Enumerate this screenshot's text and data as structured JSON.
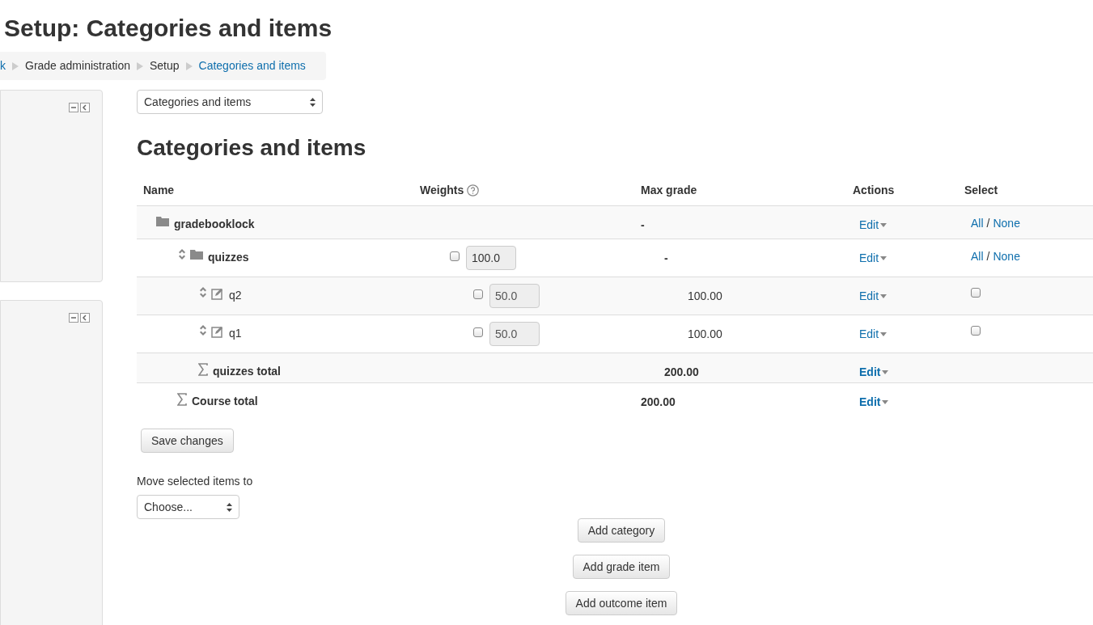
{
  "page_title": "Setup: Categories and items",
  "breadcrumb": [
    {
      "label": "k",
      "link": true
    },
    {
      "label": "Grade administration",
      "link": false
    },
    {
      "label": "Setup",
      "link": false
    },
    {
      "label": "Categories and items",
      "link": true
    }
  ],
  "sidebar_blocks": [
    {
      "kind": "block"
    },
    {
      "kind": "block"
    }
  ],
  "view_select": {
    "value": "Categories and items"
  },
  "heading": "Categories and items",
  "table": {
    "columns": [
      "Name",
      "Weights",
      "Max grade",
      "Actions",
      "Select"
    ],
    "rows": [
      {
        "kind": "category",
        "name": "gradebooklock",
        "max_grade": "-",
        "action": "Edit",
        "select_all": "All",
        "select_sep": "/",
        "select_none": "None",
        "children": [
          {
            "kind": "category",
            "name": "quizzes",
            "movable": true,
            "weight": {
              "checked": false,
              "value": "100.0"
            },
            "max_grade": "-",
            "action": "Edit",
            "select_all": "All",
            "select_sep": "/",
            "select_none": "None",
            "children": [
              {
                "kind": "item",
                "name": "q2",
                "movable": true,
                "weight": {
                  "checked": false,
                  "value": "50.0"
                },
                "max_grade": "100.00",
                "action": "Edit",
                "select": {
                  "checked": false
                }
              },
              {
                "kind": "item",
                "name": "q1",
                "movable": true,
                "weight": {
                  "checked": false,
                  "value": "50.0"
                },
                "max_grade": "100.00",
                "action": "Edit",
                "select": {
                  "checked": false
                }
              },
              {
                "kind": "total",
                "name": "quizzes total",
                "max_grade": "200.00",
                "action": "Edit"
              }
            ]
          },
          {
            "kind": "total",
            "name": "Course total",
            "max_grade": "200.00",
            "action": "Edit"
          }
        ]
      }
    ]
  },
  "save_button": "Save changes",
  "move_label": "Move selected items to",
  "move_select": {
    "value": "Choose..."
  },
  "buttons": [
    "Add category",
    "Add grade item",
    "Add outcome item"
  ]
}
